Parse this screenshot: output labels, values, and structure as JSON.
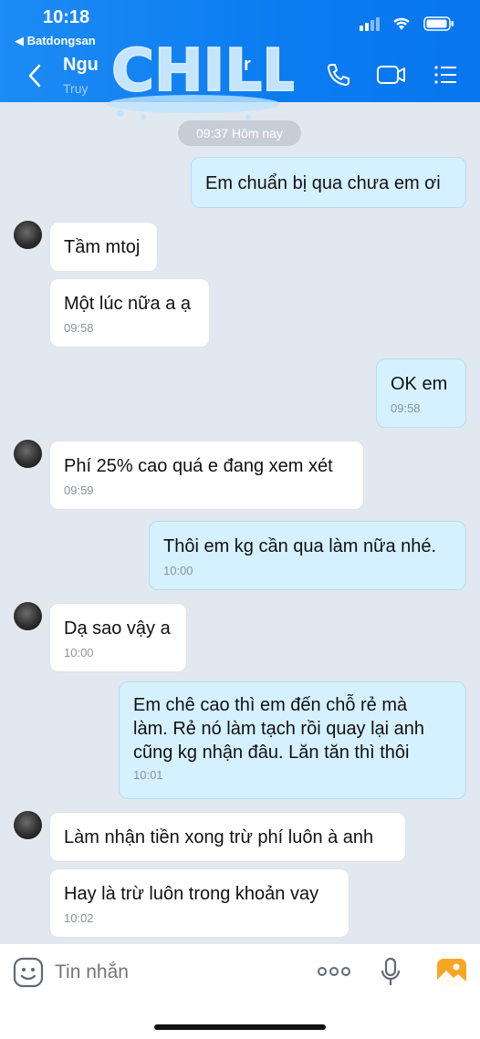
{
  "status_bar": {
    "time": "10:18",
    "back_app": "◀ Batdongsan"
  },
  "header": {
    "name_visible": "Ngu",
    "name_tail": "r",
    "subtitle": "Truy",
    "sticker_text": "CHILL"
  },
  "chat": {
    "date_chip": "09:37 Hôm nay",
    "messages": [
      {
        "dir": "out",
        "text": "Em chuẩn bị qua chưa em ơi",
        "time": ""
      },
      {
        "dir": "in",
        "text": "Tầm mtoj",
        "time": ""
      },
      {
        "dir": "in",
        "text": "Một lúc nữa a ạ",
        "time": "09:58"
      },
      {
        "dir": "out",
        "text": "OK em",
        "time": "09:58"
      },
      {
        "dir": "in",
        "text": "Phí 25% cao quá e đang xem xét",
        "time": "09:59"
      },
      {
        "dir": "out",
        "text": "Thôi em kg cần qua làm nữa nhé.",
        "time": "10:00"
      },
      {
        "dir": "in",
        "text": "Dạ sao vậy a",
        "time": "10:00"
      },
      {
        "dir": "out",
        "text": "Em chê cao thì em đến chỗ rẻ mà\nlàm. Rẻ nó làm tạch  rồi quay lại anh\ncũng kg nhận đâu. Lăn tăn thì thôi",
        "time": "10:01"
      },
      {
        "dir": "in",
        "text": "Làm nhận tiền xong trừ phí luôn à anh",
        "time": ""
      },
      {
        "dir": "in",
        "text": "Hay là trừ luôn trong khoản vay",
        "time": "10:02"
      }
    ]
  },
  "input_bar": {
    "placeholder": "Tin nhắn"
  },
  "colors": {
    "header": "#0a7cf0",
    "bubble_out": "#d5f0ff",
    "bubble_in": "#ffffff",
    "background": "#e2e8f0"
  }
}
